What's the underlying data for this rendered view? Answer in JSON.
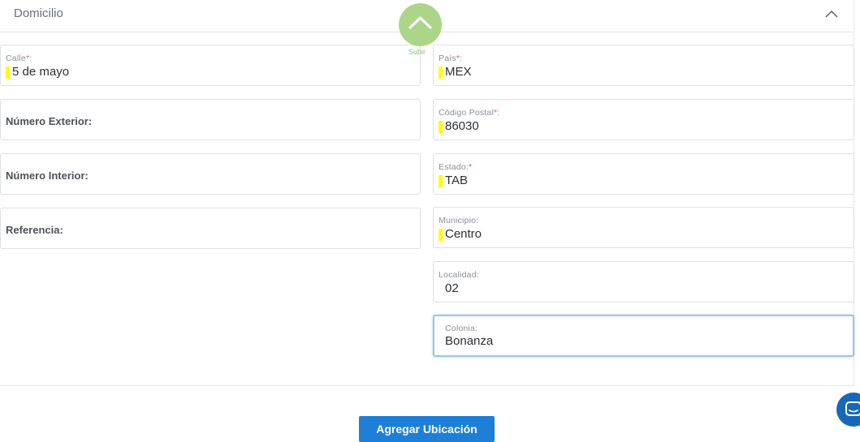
{
  "section": {
    "title": "Domicilio",
    "collapse_icon": "chevron-up-icon"
  },
  "scroll_top": {
    "icon": "chevron-up-icon",
    "label": "Subir",
    "color": "#a6d27e"
  },
  "left_fields": [
    {
      "label": "Calle",
      "required": "*",
      "suffix": ":",
      "value": "5 de mayo",
      "highlighted": true
    },
    {
      "label": "Número Exterior:",
      "value": ""
    },
    {
      "label": "Número Interior:",
      "value": ""
    },
    {
      "label": "Referencia:",
      "value": ""
    }
  ],
  "right_fields": [
    {
      "label": "País",
      "required": "*",
      "suffix": ":",
      "value": "MEX",
      "highlighted": true
    },
    {
      "label": "Código Postal",
      "required": "*",
      "suffix": ":",
      "value": "86030",
      "highlighted": true
    },
    {
      "label": "Estado:",
      "required": "*",
      "value": "TAB",
      "highlighted": true
    },
    {
      "label": "Municipio:",
      "value": "Centro",
      "highlighted": true
    },
    {
      "label": "Localidad:",
      "value": "02",
      "highlighted": false
    },
    {
      "label": "Colonia:",
      "value": "Bonanza",
      "highlighted": false,
      "focused": true
    }
  ],
  "actions": {
    "add_location_label": "Agregar Ubicación",
    "button_color": "#1e7fd9"
  },
  "chat": {
    "icon": "chat-icon",
    "color": "#1769b8"
  },
  "colors": {
    "highlight_mark": "#ffff00",
    "required": "#e05a6a"
  }
}
